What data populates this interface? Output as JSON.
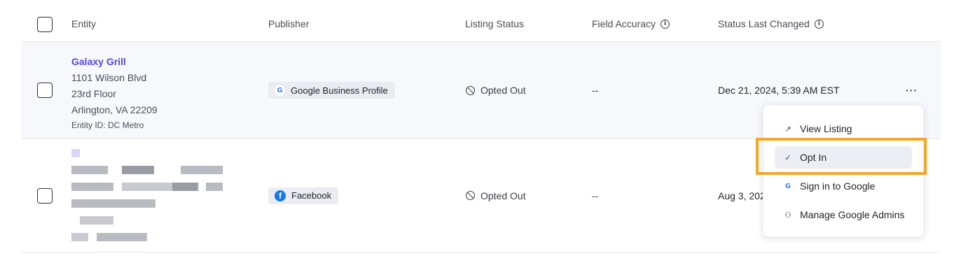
{
  "headers": {
    "entity": "Entity",
    "publisher": "Publisher",
    "listing_status": "Listing Status",
    "field_accuracy": "Field Accuracy",
    "status_last_changed": "Status Last Changed"
  },
  "rows": [
    {
      "entity_name": "Galaxy Grill",
      "address_line1": "1101 Wilson Blvd",
      "address_line2": "23rd Floor",
      "address_line3": "Arlington, VA 22209",
      "entity_id": "Entity ID: DC Metro",
      "publisher": "Google Business Profile",
      "publisher_icon": "google-icon",
      "listing_status": "Opted Out",
      "field_accuracy": "--",
      "status_last_changed": "Dec 21, 2024, 5:39 AM EST",
      "more": "···"
    },
    {
      "publisher": "Facebook",
      "publisher_icon": "facebook-icon",
      "listing_status": "Opted Out",
      "field_accuracy": "--",
      "status_last_changed": "Aug 3, 202"
    }
  ],
  "menu": {
    "items": [
      {
        "label": "View Listing",
        "icon": "external-link-icon"
      },
      {
        "label": "Opt In",
        "icon": "check-icon"
      },
      {
        "label": "Sign in to Google",
        "icon": "google-icon"
      },
      {
        "label": "Manage Google Admins",
        "icon": "admins-icon"
      }
    ]
  },
  "colors": {
    "accent": "#5047e0",
    "highlight": "#f5a623",
    "row_selected_bg": "#f6f8fc",
    "facebook": "#1877f2"
  }
}
